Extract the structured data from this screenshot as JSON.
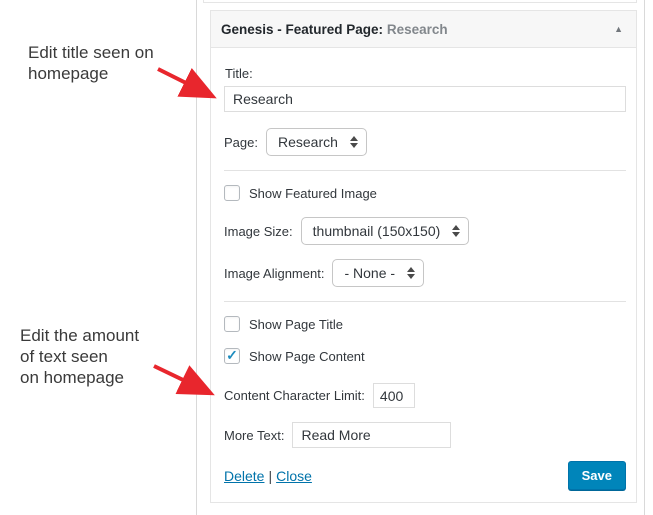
{
  "annotations": {
    "note1": {
      "line1": "Edit title seen on",
      "line2": "homepage"
    },
    "note2": {
      "line1": "Edit the amount",
      "line2": "of text seen",
      "line3": "on homepage"
    }
  },
  "widget": {
    "header": {
      "title": "Genesis - Featured Page:",
      "page_name": "Research",
      "collapse_icon": "▲"
    },
    "fields": {
      "title_label": "Title:",
      "title_value": "Research",
      "page_label": "Page:",
      "page_value": "Research",
      "show_featured_image_label": "Show Featured Image",
      "image_size_label": "Image Size:",
      "image_size_value": "thumbnail (150x150)",
      "image_alignment_label": "Image Alignment:",
      "image_alignment_value": "- None -",
      "show_page_title_label": "Show Page Title",
      "show_page_content_label": "Show Page Content",
      "show_page_content_check": "✓",
      "content_character_limit_label": "Content Character Limit:",
      "content_character_limit_value": "400",
      "more_text_label": "More Text:",
      "more_text_value": "Read More"
    },
    "footer": {
      "delete_label": "Delete",
      "separator": "|",
      "close_label": "Close",
      "save_label": "Save"
    }
  },
  "colors": {
    "save_button": "#0085ba",
    "link": "#0073aa",
    "arrow": "#e8262d",
    "checkmark": "#1e8cbe",
    "header_bg": "#f7f7f7"
  }
}
